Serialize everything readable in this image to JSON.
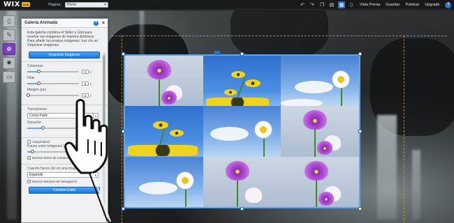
{
  "topbar": {
    "logo": "WIX",
    "beta": "beta",
    "page_label": "Página:",
    "page_value": "Home",
    "menu": [
      "Vista Previa",
      "Guardar",
      "Publicar",
      "Upgrade"
    ],
    "help": "?"
  },
  "sidebar": {
    "items": [
      {
        "name": "pages",
        "icon": "page-icon"
      },
      {
        "name": "design",
        "icon": "brush-icon"
      },
      {
        "name": "add",
        "icon": "plus-icon",
        "active": true
      },
      {
        "name": "settings",
        "icon": "gear-icon"
      },
      {
        "name": "app-market",
        "icon": "market-icon"
      }
    ]
  },
  "panel": {
    "title": "Galería Animada",
    "help": "?",
    "close": "×",
    "description": "Esta galería combina el Slider y Grid para mostrar tus imágenes de manera dinámica. Para añadir tus propias imágenes, haz clic en Organizar imágenes",
    "organize_button": "Organizar Imágenes",
    "columns_label": "Columnas",
    "columns_value": "3",
    "rows_label": "Filas",
    "rows_value": "3",
    "margin_label": "Margen (px)",
    "margin_value": "0",
    "transitions_label": "Transiciones",
    "transition_value": "Cross-Fade",
    "duration_label": "Duración",
    "autoplay_label": "Autoproducir",
    "pause_label": "Pausa entre imágenes (segundos)",
    "show_autoplay_label": "Mostrar Botón de Autoproducir",
    "click_label": "Cuando haces clic en una imagen",
    "click_value": "Expandir",
    "show_nav_label": "Mostrar Botones de Navegación",
    "change_style_button": "Cambiar Estilo"
  },
  "colors": {
    "accent_blue": "#2b6fd1",
    "active_purple": "#7a3fbf",
    "selection": "#5aa7ef"
  }
}
